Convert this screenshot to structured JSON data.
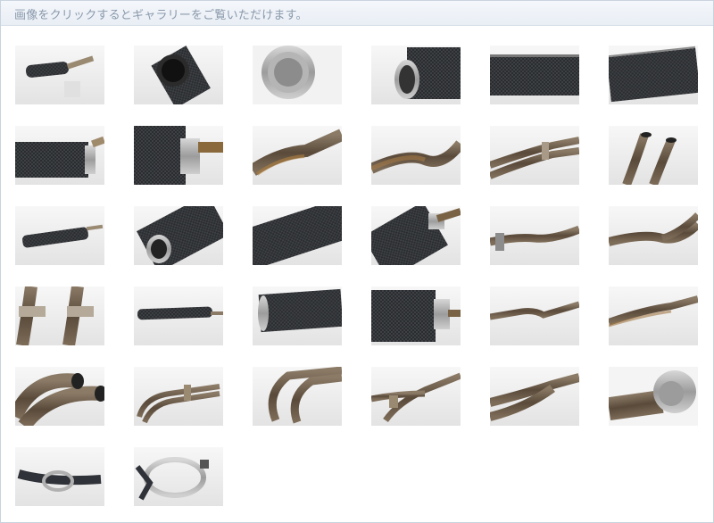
{
  "header": {
    "text": "画像をクリックするとギャラリーをご覧いただけます。"
  },
  "gallery": {
    "thumbnails": [
      "muffler-full-side",
      "muffler-outlet-dark",
      "muffler-outlet-inner",
      "muffler-carbon-end",
      "muffler-carbon-body",
      "muffler-carbon-long",
      "muffler-carbon-inlet",
      "muffler-joint-pipe",
      "header-pipe-bend",
      "header-pipe-bronze",
      "header-pipes-twin",
      "header-pipe-ends",
      "muffler-full-diagonal",
      "muffler-outlet-closeup",
      "muffler-carbon-weave",
      "muffler-inlet-pipe",
      "header-pipe-curve",
      "header-pipe-y-joint",
      "header-flanges",
      "muffler-full-horizontal",
      "muffler-carbon-side",
      "muffler-inlet-joint",
      "header-pipe-long",
      "header-pipe-straight",
      "header-pipe-loops",
      "header-pipes-assembly",
      "header-pipes-u-bends",
      "header-pipes-collector",
      "header-pipe-y-section",
      "muffler-sleeve-closeup",
      "mounting-strap",
      "mounting-band"
    ]
  }
}
